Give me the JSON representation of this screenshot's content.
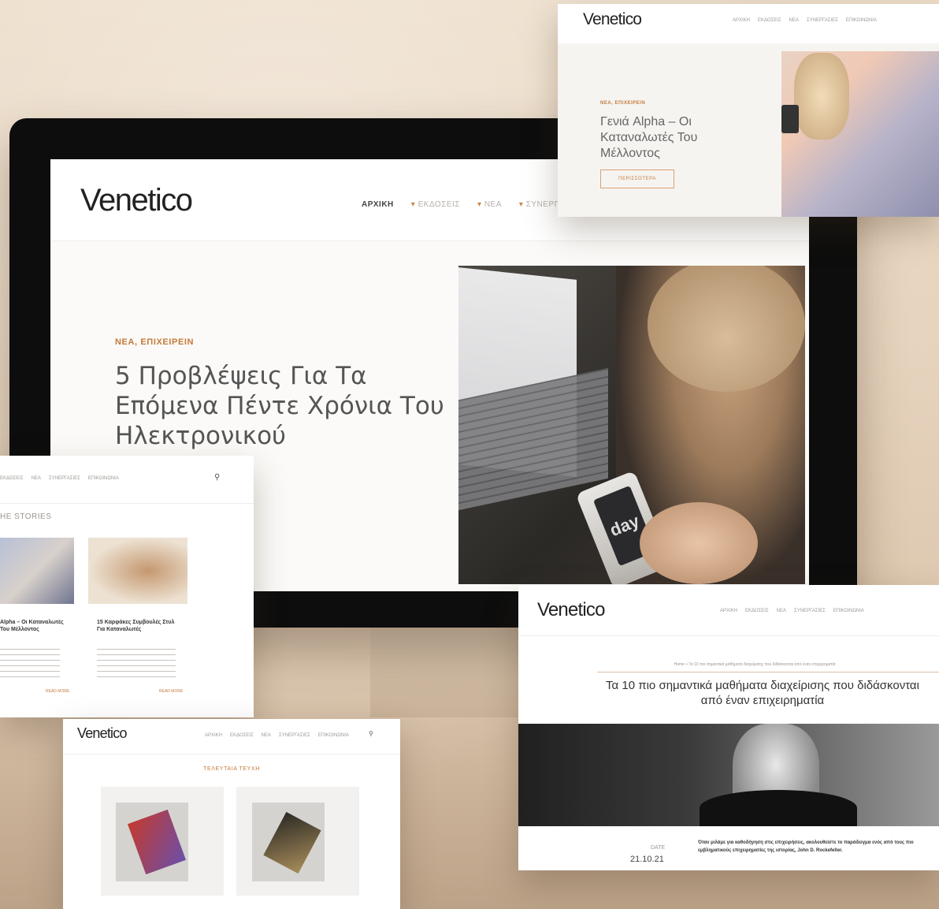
{
  "brand": {
    "name": "Venetico"
  },
  "colors": {
    "accent": "#c47a3b",
    "background": "#e6d3bd"
  },
  "main_screen": {
    "nav": [
      {
        "label": "ΑΡΧΙΚΗ",
        "active": true
      },
      {
        "label": "ΕΚΔΟΣΕΙΣ",
        "dropdown": true
      },
      {
        "label": "ΝΕΑ",
        "dropdown": true
      },
      {
        "label": "ΣΥΝΕΡΓΑΣΙΕΣ",
        "dropdown": true
      }
    ],
    "category": "ΝΕΑ, ΕΠΙΧΕΙΡΕΙΝ",
    "title": "5 Προβλέψεις Για Τα Επόμενα Πέντε Χρόνια Του Ηλεκτρονικού",
    "phone_text": "day"
  },
  "top_right_card": {
    "nav": [
      "ΑΡΧΙΚΗ",
      "ΕΚΔΟΣΕΙΣ",
      "ΝΕΑ",
      "ΣΥΝΕΡΓΑΣΙΕΣ",
      "ΕΠΙΚΟΙΝΩΝΙΑ"
    ],
    "category": "ΝΕΑ, ΕΠΙΧΕΙΡΕΙΝ",
    "title": "Γενιά Alpha – Οι Καταναλωτές Του Μέλλοντος",
    "button": "ΠΕΡΙΣΣΟΤΕΡΑ"
  },
  "left_card": {
    "nav": [
      "ΕΚΔΟΣΕΙΣ",
      "ΝΕΑ",
      "ΣΥΝΕΡΓΑΣΙΕΣ",
      "ΕΠΙΚΟΙΝΩΝΙΑ"
    ],
    "section": "HE STORIES",
    "item1_title": "Alpha – Οι Καταναλωτές Του Μέλλοντος",
    "item2_title": "15 Καρφάκες Συμβουλές Στυλ Για Καταναλωτές",
    "more": "READ MORE"
  },
  "bottom_middle_card": {
    "nav": [
      "ΑΡΧΙΚΗ",
      "ΕΚΔΟΣΕΙΣ",
      "ΝΕΑ",
      "ΣΥΝΕΡΓΑΣΙΕΣ",
      "ΕΠΙΚΟΙΝΩΝΙΑ"
    ],
    "section": "ΤΕΛΕΥΤΑΙΑ ΤΕΥΧΗ"
  },
  "bottom_right_card": {
    "nav": [
      "ΑΡΧΙΚΗ",
      "ΕΚΔΟΣΕΙΣ",
      "ΝΕΑ",
      "ΣΥΝΕΡΓΑΣΙΕΣ",
      "ΕΠΙΚΟΙΝΩΝΙΑ"
    ],
    "breadcrumb": "Home » Τα 10 πιο σημαντικά μαθήματα διαχείρισης που διδάσκονται από έναν επιχειρηματία",
    "title": "Τα 10 πιο σημαντικά μαθήματα διαχείρισης που διδάσκονται από έναν επιχειρηματία",
    "date_label": "DATE",
    "date": "21.10.21",
    "excerpt": "Όταν μιλάμε για καθοδήγηση στις επιχειρήσεις, ακολουθείστε το παράδειγμα ενός από τους πιο εμβληματικούς επιχειρηματίες της ιστορίας, John D. Rockefeller."
  }
}
